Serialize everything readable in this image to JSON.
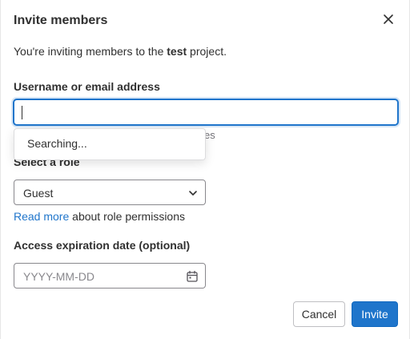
{
  "modal": {
    "title": "Invite members",
    "close_icon": "close-icon",
    "intro_prefix": "You're inviting members to the ",
    "project_name": "test",
    "intro_suffix": " project."
  },
  "invitee": {
    "label": "Username or email address",
    "value": "",
    "dropdown_text": "Searching...",
    "hint_tail": "es"
  },
  "role": {
    "label": "Select a role",
    "selected": "Guest",
    "chevron_icon": "chevron-down-icon",
    "read_more_link": "Read more",
    "read_more_suffix": " about role permissions"
  },
  "expiration": {
    "label": "Access expiration date (optional)",
    "placeholder": "YYYY-MM-DD",
    "calendar_icon": "calendar-icon"
  },
  "footer": {
    "cancel_label": "Cancel",
    "invite_label": "Invite"
  },
  "colors": {
    "primary": "#1f75cb",
    "text": "#303030",
    "muted": "#737278"
  }
}
